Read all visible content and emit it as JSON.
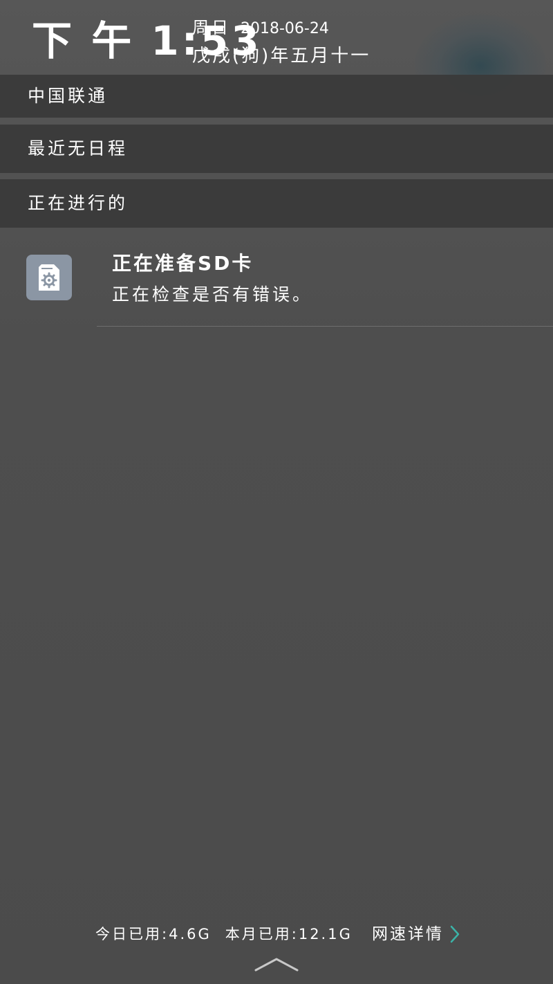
{
  "header": {
    "time": "下 午 1:53",
    "day_of_week": "周日",
    "date": "2018-06-24",
    "lunar_date": "戊戌(狗)年五月十一"
  },
  "sections": {
    "carrier": "中国联通",
    "schedule": "最近无日程",
    "ongoing": "正在进行的"
  },
  "notification": {
    "icon": "sd-card-settings-icon",
    "title": "正在准备SD卡",
    "text": "正在检查是否有错误。"
  },
  "footer": {
    "today_used_label": "今日已用:",
    "today_used_value": "4.6G",
    "month_used_label": "本月已用:",
    "month_used_value": "12.1G",
    "details_label": "网速详情"
  },
  "colors": {
    "background": "#4b4b4b",
    "section_bar": "#3a3a3a",
    "icon_bg": "#8b96a4",
    "accent_chevron": "#3bb3a8",
    "text": "#ffffff"
  }
}
